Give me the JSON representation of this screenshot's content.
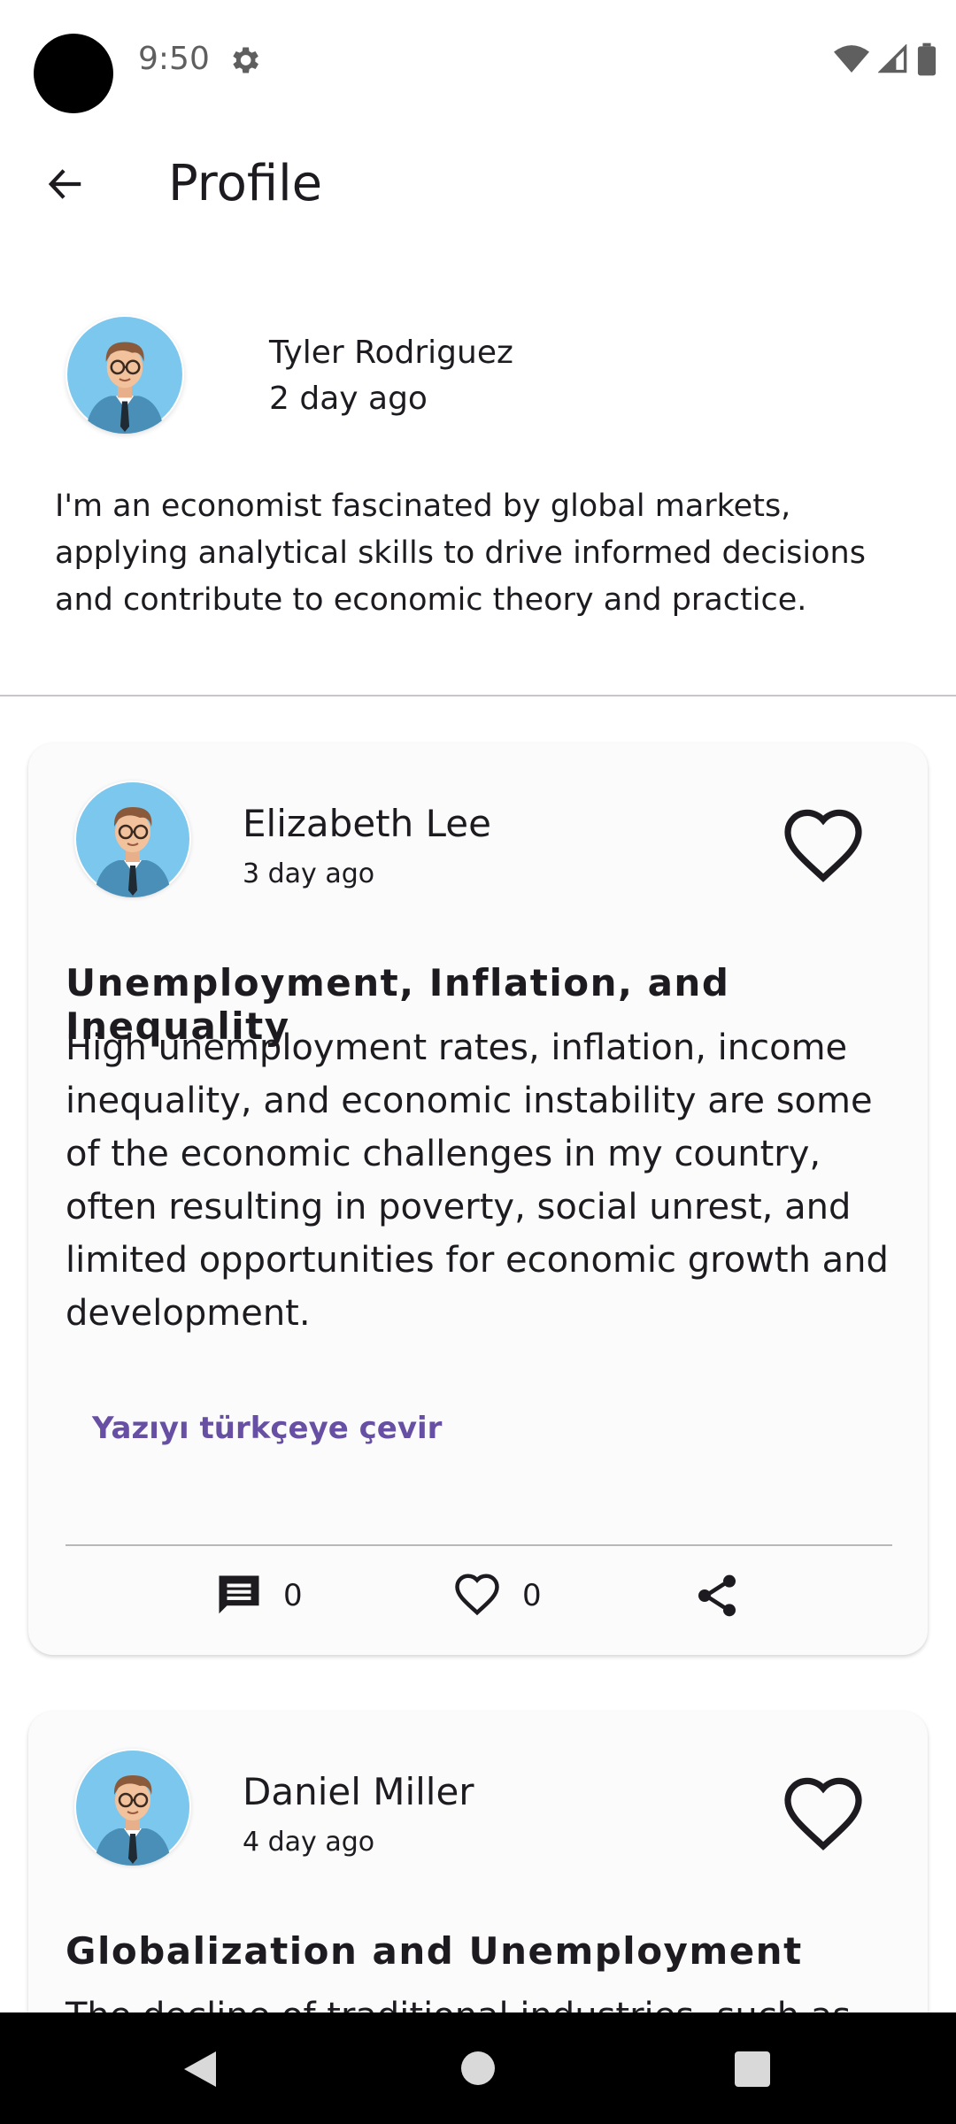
{
  "status_bar": {
    "time": "9:50"
  },
  "app_bar": {
    "title": "Profile"
  },
  "profile": {
    "name": "Tyler Rodriguez",
    "time": "2 day ago",
    "bio": "I'm an economist fascinated by global markets, applying analytical skills to drive informed decisions and contribute to economic theory and practice."
  },
  "posts": [
    {
      "author": "Elizabeth Lee",
      "time": "3 day ago",
      "title": "Unemployment, Inflation, and Inequality",
      "body": "High unemployment rates, inflation, income inequality, and economic instability are some of the economic challenges in my country, often resulting in poverty, social unrest, and limited opportunities for economic growth and development.",
      "translate_label": "Yazıyı türkçeye çevir",
      "comments": "0",
      "likes": "0"
    },
    {
      "author": "Daniel Miller",
      "time": "4 day ago",
      "title": "Globalization and Unemployment",
      "body": "The decline of traditional industries, such as"
    }
  ],
  "colors": {
    "accent": "#6750a4",
    "avatar_bg": "#7cc7ee",
    "text": "#1d1b20"
  },
  "icons": {
    "back": "arrow-left-icon",
    "favorite": "heart-outline-icon",
    "comment": "comment-icon",
    "like": "heart-outline-icon",
    "share": "share-icon"
  }
}
